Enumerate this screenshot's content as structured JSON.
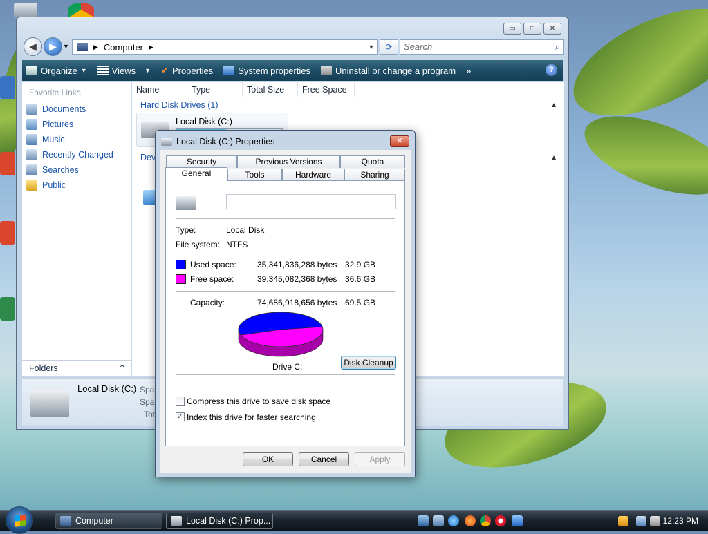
{
  "explorer": {
    "address": "Computer",
    "search_placeholder": "Search",
    "toolbar": {
      "organize": "Organize",
      "views": "Views",
      "properties": "Properties",
      "system_properties": "System properties",
      "uninstall": "Uninstall or change a program",
      "more": "»",
      "help": "?"
    },
    "nav": {
      "header": "Favorite Links",
      "links": [
        "Documents",
        "Pictures",
        "Music",
        "Recently Changed",
        "Searches",
        "Public"
      ],
      "folders": "Folders"
    },
    "columns": [
      "Name",
      "Type",
      "Total Size",
      "Free Space"
    ],
    "group1": "Hard Disk Drives (1)",
    "group2": "Dev",
    "drive_name": "Local Disk (C:)",
    "drive_used_fraction": 0.47,
    "details": {
      "name": "Local Disk (C:)",
      "labels": [
        "Spac",
        "Spac",
        "Tot"
      ]
    }
  },
  "dialog": {
    "title": "Local Disk (C:) Properties",
    "tabs_row1": [
      "Security",
      "Previous Versions",
      "Quota"
    ],
    "tabs_row2": [
      "General",
      "Tools",
      "Hardware",
      "Sharing"
    ],
    "name_value": "",
    "type_label": "Type:",
    "type_value": "Local Disk",
    "fs_label": "File system:",
    "fs_value": "NTFS",
    "used_label": "Used space:",
    "used_bytes": "35,341,836,288 bytes",
    "used_gb": "32.9 GB",
    "free_label": "Free space:",
    "free_bytes": "39,345,082,368 bytes",
    "free_gb": "36.6 GB",
    "capacity_label": "Capacity:",
    "capacity_bytes": "74,686,918,656 bytes",
    "capacity_gb": "69.5 GB",
    "used_fraction": 0.473,
    "drive_label": "Drive C:",
    "cleanup_button": "Disk Cleanup",
    "compress_label": "Compress this drive to save disk space",
    "compress_checked": false,
    "index_label": "Index this drive for faster searching",
    "index_checked": true,
    "ok": "OK",
    "cancel": "Cancel",
    "apply": "Apply",
    "colors": {
      "used": "#0000ff",
      "free": "#ff00ff"
    }
  },
  "taskbar": {
    "tasks": [
      "Computer",
      "Local Disk (C:) Prop..."
    ],
    "clock": "12:23 PM"
  }
}
